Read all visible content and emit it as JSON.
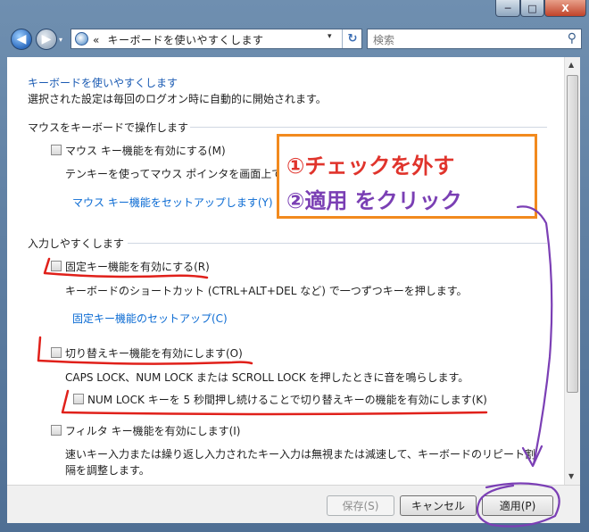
{
  "window": {
    "min": "─",
    "max": "□",
    "close": "X"
  },
  "nav": {
    "back": "◀",
    "forward": "▶",
    "history": "▾",
    "address_prefix": "«",
    "address": "キーボードを使いやすくします",
    "address_dropdown": "▾",
    "refresh": "↻",
    "search_placeholder": "検索",
    "search_icon": "search-icon"
  },
  "main": {
    "title": "キーボードを使いやすくします",
    "subtitle": "選択された設定は毎回のログオン時に自動的に開始されます。",
    "section_mouse": "マウスをキーボードで操作します",
    "mouse_keys_label": "マウス キー機能を有効にする(M)",
    "mouse_keys_desc": "テンキーを使ってマウス ポインタを画面上で",
    "mouse_keys_link": "マウス キー機能をセットアップします(Y)",
    "section_typing": "入力しやすくします",
    "sticky_label": "固定キー機能を有効にする(R)",
    "sticky_desc": "キーボードのショートカット (CTRL+ALT+DEL など) で一つずつキーを押します。",
    "sticky_link": "固定キー機能のセットアップ(C)",
    "toggle_label": "切り替えキー機能を有効にします(O)",
    "toggle_desc": "CAPS LOCK、NUM LOCK または SCROLL LOCK を押したときに音を鳴らします。",
    "numlock_label": "NUM LOCK キーを 5 秒間押し続けることで切り替えキーの機能を有効にします(K)",
    "filter_label": "フィルタ キー機能を有効にします(I)",
    "filter_desc1": "速いキー入力または繰り返し入力されたキー入力は無視または減速して、キーボードのリピート割",
    "filter_desc2": "隔を調整します。"
  },
  "footer": {
    "save": "保存(S)",
    "cancel": "キャンセル",
    "apply": "適用(P)"
  },
  "annotation": {
    "line1": "①チェックを外す",
    "line2": "②適用 をクリック",
    "box_color": "#f28a1e",
    "line1_color": "#e0342c",
    "line2_color": "#7a3fb4",
    "ink_red": "#e0201a",
    "ink_purple": "#7b3fb5"
  }
}
